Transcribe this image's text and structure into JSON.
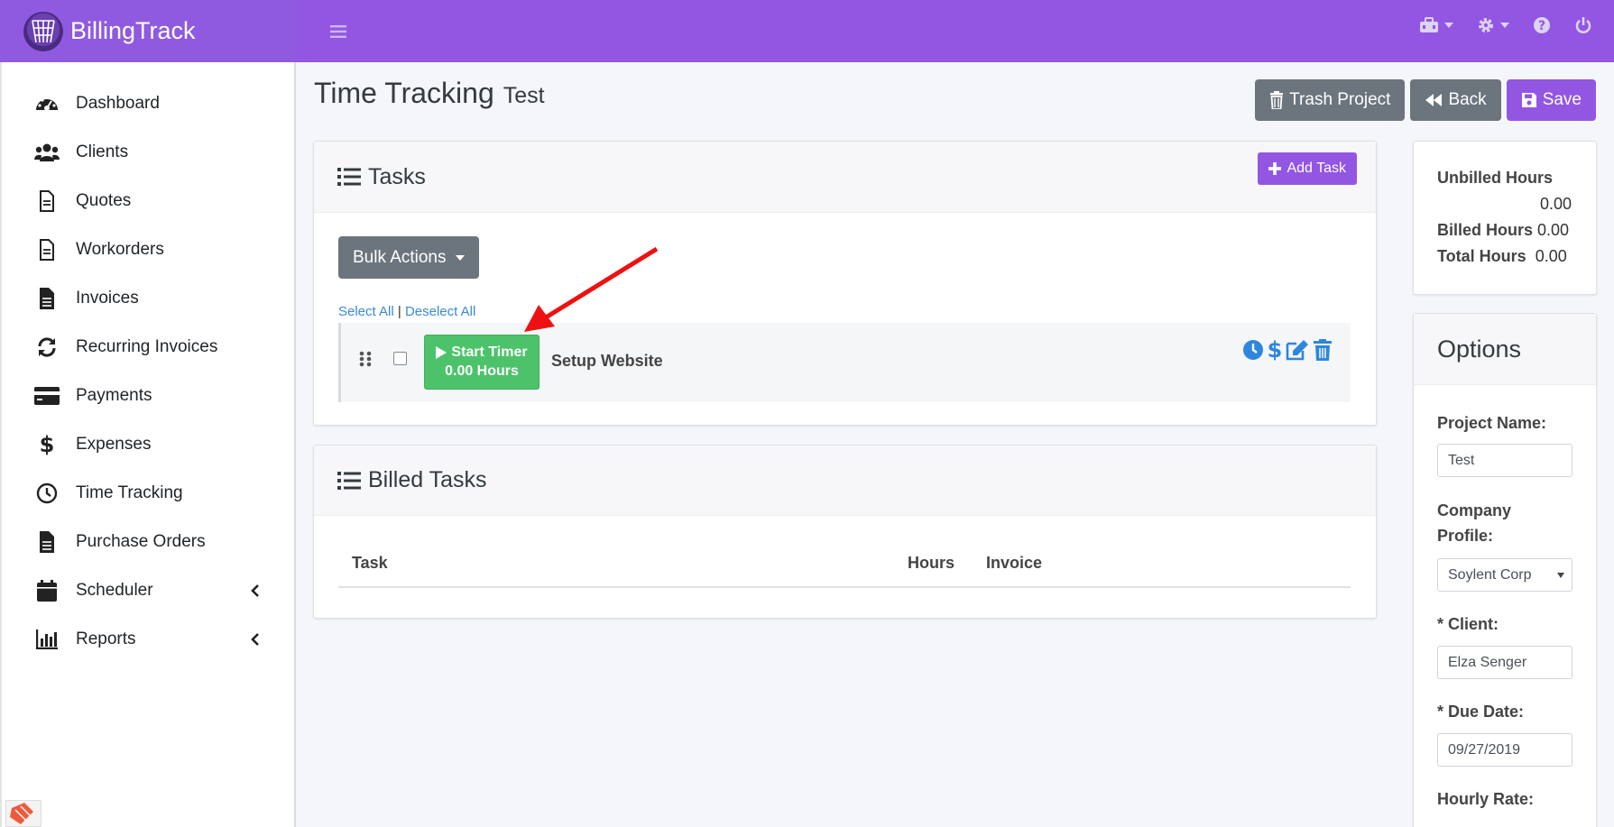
{
  "app": {
    "name": "BillingTrack"
  },
  "sidebar": {
    "items": [
      {
        "label": "Dashboard",
        "icon": "dashboard-icon"
      },
      {
        "label": "Clients",
        "icon": "users-icon"
      },
      {
        "label": "Quotes",
        "icon": "file-icon"
      },
      {
        "label": "Workorders",
        "icon": "file-icon"
      },
      {
        "label": "Invoices",
        "icon": "file-solid-icon"
      },
      {
        "label": "Recurring Invoices",
        "icon": "sync-icon"
      },
      {
        "label": "Payments",
        "icon": "credit-card-icon"
      },
      {
        "label": "Expenses",
        "icon": "dollar-icon"
      },
      {
        "label": "Time Tracking",
        "icon": "clock-icon"
      },
      {
        "label": "Purchase Orders",
        "icon": "file-solid-icon"
      },
      {
        "label": "Scheduler",
        "icon": "calendar-icon"
      },
      {
        "label": "Reports",
        "icon": "chart-icon"
      }
    ]
  },
  "header": {
    "title": "Time Tracking",
    "subtitle": "Test",
    "trash_label": "Trash Project",
    "back_label": "Back",
    "save_label": "Save"
  },
  "tasks": {
    "title": "Tasks",
    "add_label": "Add Task",
    "bulk_label": "Bulk Actions",
    "select_all": "Select All",
    "separator": "|",
    "deselect_all": "Deselect All",
    "rows": [
      {
        "timer_label": "Start Timer",
        "hours": "0.00 Hours",
        "name": "Setup Website"
      }
    ]
  },
  "billed": {
    "title": "Billed Tasks",
    "columns": [
      "Task",
      "Hours",
      "Invoice"
    ]
  },
  "summary": {
    "unbilled_label": "Unbilled Hours",
    "unbilled_value": "0.00",
    "billed_label": "Billed Hours",
    "billed_value": "0.00",
    "total_label": "Total Hours",
    "total_value": "0.00"
  },
  "options": {
    "title": "Options",
    "project_name_label": "Project Name:",
    "project_name_value": "Test",
    "company_label_1": "Company",
    "company_label_2": "Profile:",
    "company_value": "Soylent Corp",
    "client_label": "* Client:",
    "client_value": "Elza Senger",
    "due_label": "* Due Date:",
    "due_value": "09/27/2019",
    "rate_label": "Hourly Rate:"
  },
  "colors": {
    "brand": "#8f5ae0",
    "topbar": "#9356e3",
    "timer_green": "#4cc36a",
    "action_blue": "#2e86de",
    "annotation_red": "#ee1111"
  }
}
